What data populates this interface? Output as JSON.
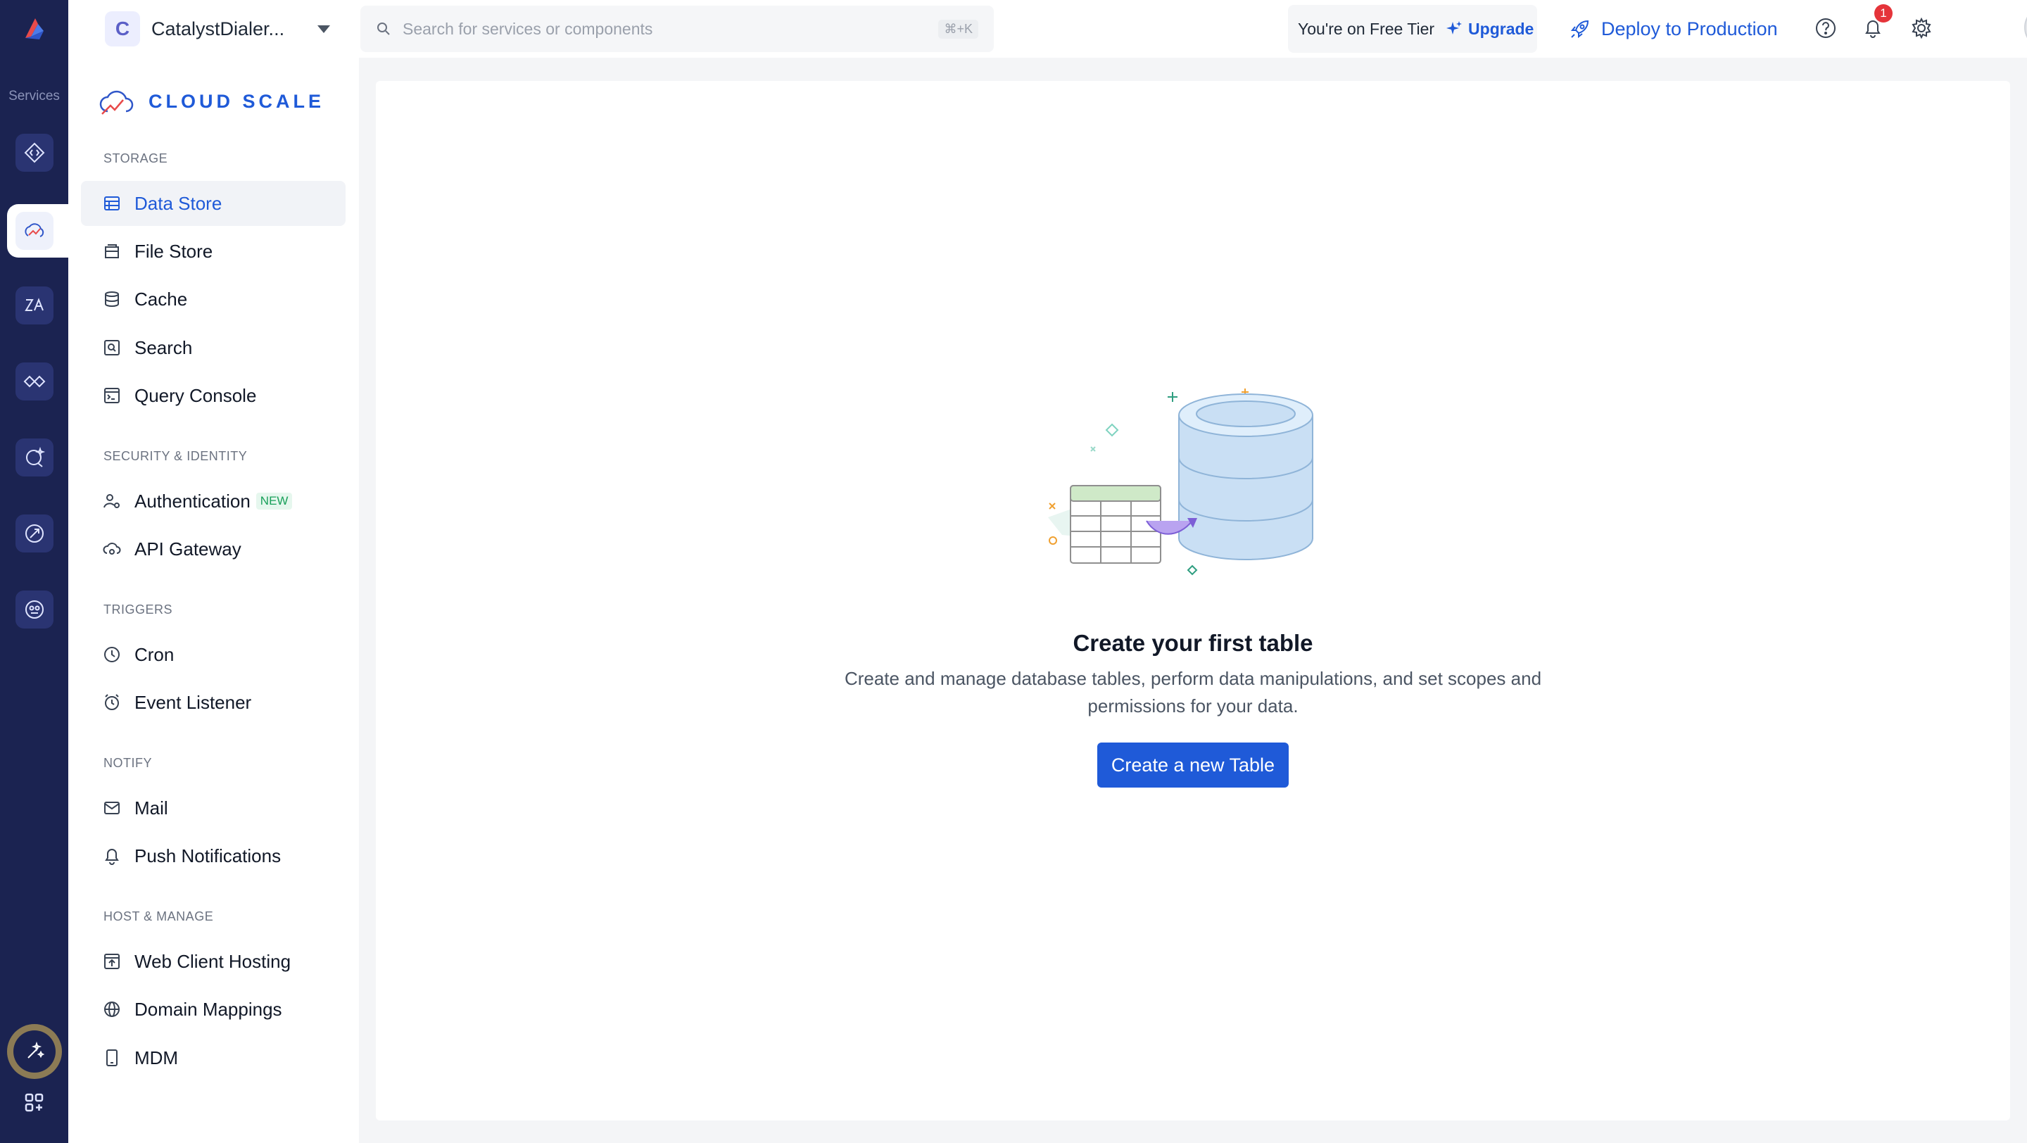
{
  "rail": {
    "services_label": "Services"
  },
  "topbar": {
    "project_initial": "C",
    "project_name": "CatalystDialer...",
    "search_placeholder": "Search for services or components",
    "search_shortcut": "⌘+K",
    "tier_text": "You're on Free Tier",
    "upgrade_label": "Upgrade",
    "deploy_label": "Deploy to Production",
    "notification_count": "1"
  },
  "sidebar": {
    "brand": "CLOUD SCALE",
    "sections": {
      "storage": "STORAGE",
      "security": "SECURITY & IDENTITY",
      "triggers": "TRIGGERS",
      "notify": "NOTIFY",
      "host": "HOST & MANAGE"
    },
    "items": {
      "data_store": "Data Store",
      "file_store": "File Store",
      "cache": "Cache",
      "search": "Search",
      "query_console": "Query Console",
      "authentication": "Authentication",
      "authentication_badge": "NEW",
      "api_gateway": "API Gateway",
      "cron": "Cron",
      "event_listener": "Event Listener",
      "mail": "Mail",
      "push_notifications": "Push Notifications",
      "web_client_hosting": "Web Client Hosting",
      "domain_mappings": "Domain Mappings",
      "mdm": "MDM"
    }
  },
  "main": {
    "empty_title": "Create your first table",
    "empty_desc": "Create and manage database tables, perform data manipulations, and set scopes and permissions for your data.",
    "create_button": "Create a new Table"
  },
  "colors": {
    "rail_bg": "#1b2351",
    "accent": "#1f5ad8",
    "badge": "#e5343a",
    "new_badge": "#19a05a"
  }
}
